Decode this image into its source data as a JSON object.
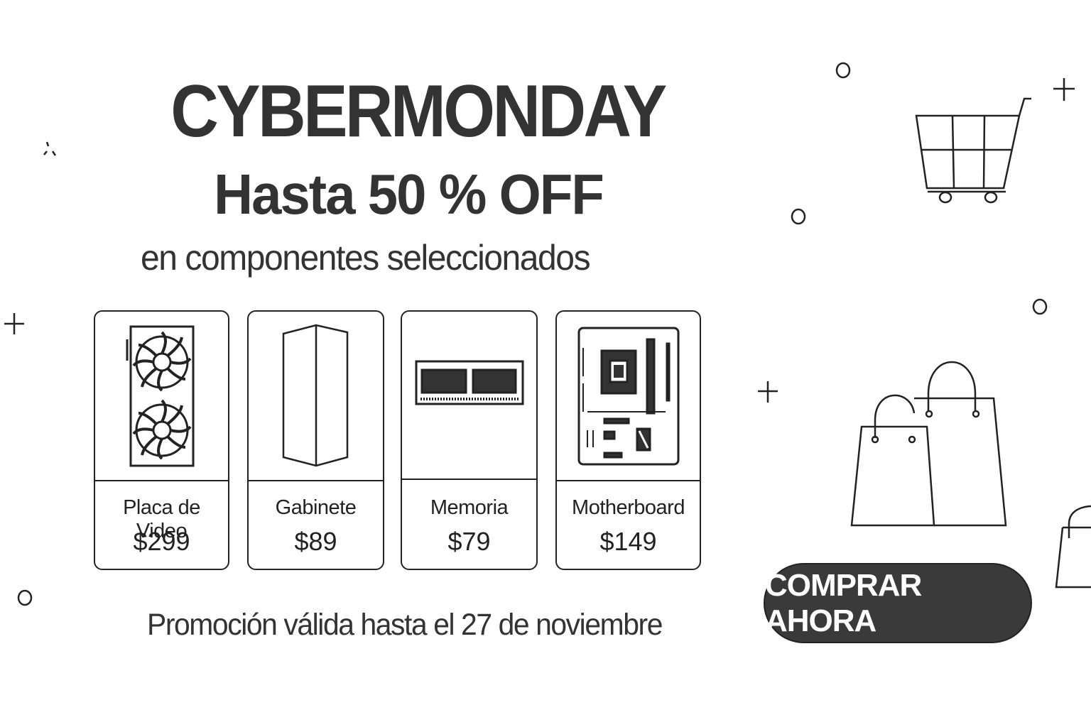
{
  "headline": "CYBERMONDAY",
  "discount": "Hasta 50 % OFF",
  "subheadline": "en componentes seleccionados",
  "products": [
    {
      "name": "Placa de Video",
      "price": "$299",
      "icon": "graphics-card-icon"
    },
    {
      "name": "Gabinete",
      "price": "$89",
      "icon": "pc-case-icon"
    },
    {
      "name": "Memoria",
      "price": "$79",
      "icon": "ram-memory-icon"
    },
    {
      "name": "Motherboard",
      "price": "$149",
      "icon": "motherboard-icon"
    }
  ],
  "validity": "Promoción válida hasta el 27 de noviembre",
  "cta": {
    "label": "COMPRAR AHORA",
    "background": "#3a3a3a",
    "text_color": "#ffffff"
  },
  "decorations": [
    "shopping-cart-icon",
    "shopping-bags-icon",
    "circle-icon",
    "plus-icon"
  ]
}
